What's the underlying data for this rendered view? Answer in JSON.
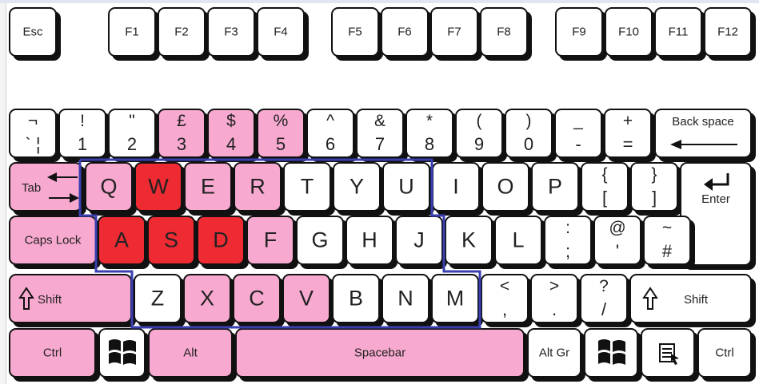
{
  "function_row": {
    "esc": "Esc",
    "f1": "F1",
    "f2": "F2",
    "f3": "F3",
    "f4": "F4",
    "f5": "F5",
    "f6": "F6",
    "f7": "F7",
    "f8": "F8",
    "f9": "F9",
    "f10": "F10",
    "f11": "F11",
    "f12": "F12"
  },
  "number_row": {
    "backtick": {
      "top": "¬",
      "bottom": "` ¦"
    },
    "n1": {
      "top": "!",
      "bottom": "1"
    },
    "n2": {
      "top": "\"",
      "bottom": "2"
    },
    "n3": {
      "top": "£",
      "bottom": "3"
    },
    "n4": {
      "top": "$",
      "bottom": "4"
    },
    "n5": {
      "top": "%",
      "bottom": "5"
    },
    "n6": {
      "top": "^",
      "bottom": "6"
    },
    "n7": {
      "top": "&",
      "bottom": "7"
    },
    "n8": {
      "top": "*",
      "bottom": "8"
    },
    "n9": {
      "top": "(",
      "bottom": "9"
    },
    "n0": {
      "top": ")",
      "bottom": "0"
    },
    "minus": {
      "top": "_",
      "bottom": "-"
    },
    "equals": {
      "top": "+",
      "bottom": "="
    },
    "backspace": "Back space"
  },
  "top_row": {
    "tab": "Tab",
    "q": "Q",
    "w": "W",
    "e": "E",
    "r": "R",
    "t": "T",
    "y": "Y",
    "u": "U",
    "i": "I",
    "o": "O",
    "p": "P",
    "lbracket": {
      "top": "{",
      "bottom": "["
    },
    "rbracket": {
      "top": "}",
      "bottom": "]"
    },
    "enter": "Enter"
  },
  "home_row": {
    "caps": "Caps Lock",
    "a": "A",
    "s": "S",
    "d": "D",
    "f": "F",
    "g": "G",
    "h": "H",
    "j": "J",
    "k": "K",
    "l": "L",
    "semicolon": {
      "top": ":",
      "bottom": ";"
    },
    "quote": {
      "top": "@",
      "bottom": "'"
    },
    "hash": {
      "top": "~",
      "bottom": "#"
    }
  },
  "bottom_row": {
    "lshift": "Shift",
    "z": "Z",
    "x": "X",
    "c": "C",
    "v": "V",
    "b": "B",
    "n": "N",
    "m": "M",
    "comma": {
      "top": "<",
      "bottom": ","
    },
    "period": {
      "top": ">",
      "bottom": "."
    },
    "slash": {
      "top": "?",
      "bottom": "/"
    },
    "rshift": "Shift"
  },
  "space_row": {
    "lctrl": "Ctrl",
    "lwin": "windows-logo-icon",
    "alt": "Alt",
    "spacebar": "Spacebar",
    "altgr": "Alt Gr",
    "rwin": "windows-logo-icon",
    "menu": "menu-icon",
    "rctrl": "Ctrl"
  },
  "colors": {
    "key_white": "#ffffff",
    "key_pink": "#f8a9d0",
    "key_red": "#ee2a32",
    "outline_blue": "#3a3fb0",
    "key_border": "#111111"
  }
}
